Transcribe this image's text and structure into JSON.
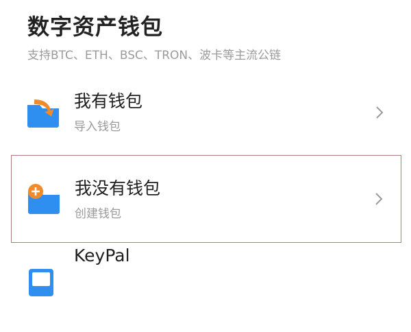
{
  "header": {
    "title": "数字资产钱包",
    "subtitle": "支持BTC、ETH、BSC、TRON、波卡等主流公链"
  },
  "options": [
    {
      "label": "我有钱包",
      "sub": "导入钱包",
      "icon": "import-wallet-icon",
      "selected": false
    },
    {
      "label": "我没有钱包",
      "sub": "创建钱包",
      "icon": "create-wallet-icon",
      "selected": true
    },
    {
      "label": "KeyPal",
      "icon": "hardware-wallet-icon",
      "selected": false
    }
  ],
  "colors": {
    "accent_blue": "#2f8ff0",
    "accent_orange": "#f08a2a",
    "selected_border": "#b07a7a"
  }
}
